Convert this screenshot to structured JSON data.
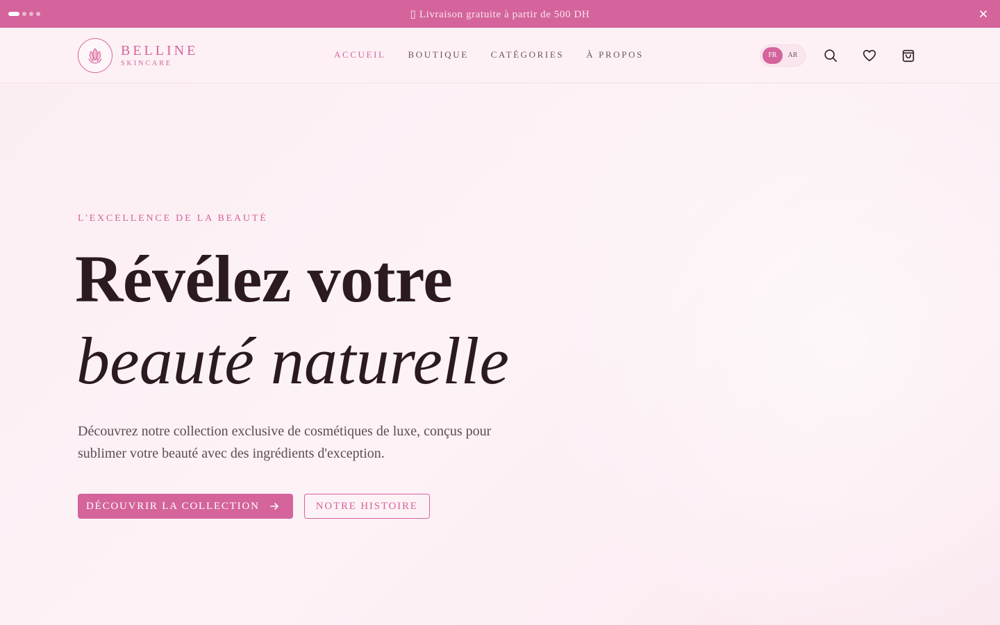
{
  "announcement": {
    "text": "▯ Livraison gratuite à partir de 500 DH",
    "close_icon": "close-icon",
    "dots_count": 4,
    "active_dot": 1
  },
  "header": {
    "brand": "BELLINE",
    "brand_sub": "SKINCARE",
    "logo_icon": "lotus-hands-icon",
    "nav": [
      {
        "label": "ACCUEIL",
        "active": true
      },
      {
        "label": "BOUTIQUE",
        "active": false
      },
      {
        "label": "CATÉGORIES",
        "active": false
      },
      {
        "label": "À PROPOS",
        "active": false
      }
    ],
    "languages": [
      {
        "label": "FR",
        "active": true
      },
      {
        "label": "AR",
        "active": false
      }
    ],
    "icons": [
      "search-icon",
      "heart-icon",
      "shopping-bag-icon"
    ]
  },
  "hero": {
    "eyebrow": "L'EXCELLENCE DE LA BEAUTÉ",
    "title_line1": "Révélez votre",
    "title_line2": "beauté naturelle",
    "description": "Découvrez notre collection exclusive de cosmétiques de luxe, conçus pour sublimer votre beauté avec des ingrédients d'exception.",
    "primary_cta": "DÉCOUVRIR LA COLLECTION",
    "secondary_cta": "NOTRE HISTOIRE"
  },
  "colors": {
    "accent": "#d4649b",
    "text_dark": "#2b1a20",
    "background": "#fdf0f4"
  }
}
